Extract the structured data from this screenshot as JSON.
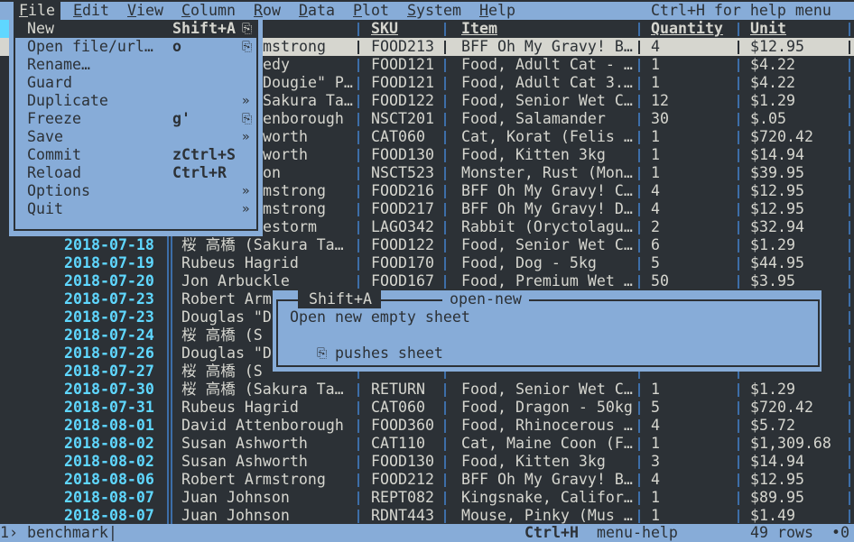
{
  "menubar": {
    "items": [
      "File",
      "Edit",
      "View",
      "Column",
      "Row",
      "Data",
      "Plot",
      "System",
      "Help"
    ],
    "hint": "Ctrl+H for help menu"
  },
  "table": {
    "headers": {
      "sku": "SKU",
      "item": "Item",
      "quantity": "Quantity",
      "unit": "Unit"
    },
    "rows": [
      {
        "date": "",
        "name": "mstrong",
        "sku": "FOOD213",
        "item": "BFF Oh My Gravy! B…",
        "qty": "4",
        "unit": "$12.95",
        "selected": true
      },
      {
        "date": "",
        "name": "edy",
        "sku": "FOOD121",
        "item": "Food, Adult Cat - …",
        "qty": "1",
        "unit": "$4.22"
      },
      {
        "date": "",
        "name": "Dougie\" P…",
        "sku": "FOOD121",
        "item": "Food, Adult Cat 3.…",
        "qty": "1",
        "unit": "$4.22"
      },
      {
        "date": "",
        "name": "Sakura Ta…",
        "sku": "FOOD122",
        "item": "Food, Senior Wet C…",
        "qty": "12",
        "unit": "$1.29"
      },
      {
        "date": "",
        "name": "enborough",
        "sku": "NSCT201",
        "item": "Food, Salamander",
        "qty": "30",
        "unit": "$.05"
      },
      {
        "date": "",
        "name": "worth",
        "sku": "CAT060",
        "item": "Cat, Korat (Felis …",
        "qty": "1",
        "unit": "$720.42"
      },
      {
        "date": "",
        "name": "worth",
        "sku": "FOOD130",
        "item": "Food, Kitten 3kg",
        "qty": "1",
        "unit": "$14.94"
      },
      {
        "date": "",
        "name": "on",
        "sku": "NSCT523",
        "item": "Monster, Rust (Mon…",
        "qty": "1",
        "unit": "$39.95"
      },
      {
        "date": "",
        "name": "mstrong",
        "sku": "FOOD216",
        "item": "BFF Oh My Gravy! C…",
        "qty": "4",
        "unit": "$12.95"
      },
      {
        "date": "",
        "name": "mstrong",
        "sku": "FOOD217",
        "item": "BFF Oh My Gravy! D…",
        "qty": "4",
        "unit": "$12.95"
      },
      {
        "date": "",
        "name": "estorm",
        "sku": "LAGO342",
        "item": "Rabbit (Oryctolagu…",
        "qty": "2",
        "unit": "$32.94"
      },
      {
        "date": "2018-07-18",
        "name": "桜 高橋 (Sakura Ta…",
        "sku": "FOOD122",
        "item": "Food, Senior Wet C…",
        "qty": "6",
        "unit": "$1.29"
      },
      {
        "date": "2018-07-19",
        "name": "Rubeus Hagrid",
        "sku": "FOOD170",
        "item": "Food, Dog - 5kg",
        "qty": "5",
        "unit": "$44.95"
      },
      {
        "date": "2018-07-20",
        "name": "Jon Arbuckle",
        "sku": "FOOD167",
        "item": "Food, Premium Wet …",
        "qty": "50",
        "unit": "$3.95"
      },
      {
        "date": "2018-07-23",
        "name": "Robert Arm",
        "sku": "",
        "item": "",
        "qty": "",
        "unit": ""
      },
      {
        "date": "2018-07-23",
        "name": "Douglas \"D",
        "sku": "",
        "item": "",
        "qty": "",
        "unit": ""
      },
      {
        "date": "2018-07-24",
        "name": "桜 高橋 (S",
        "sku": "",
        "item": "",
        "qty": "",
        "unit": ""
      },
      {
        "date": "2018-07-26",
        "name": "Douglas \"D",
        "sku": "",
        "item": "",
        "qty": "",
        "unit": ""
      },
      {
        "date": "2018-07-27",
        "name": "桜 高橋 (S",
        "sku": "",
        "item": "",
        "qty": "",
        "unit": ""
      },
      {
        "date": "2018-07-30",
        "name": "桜 高橋 (Sakura Ta…",
        "sku": "RETURN",
        "item": "Food, Senior Wet C…",
        "qty": "1",
        "unit": "$1.29"
      },
      {
        "date": "2018-07-31",
        "name": "Rubeus Hagrid",
        "sku": "CAT060",
        "item": "Food, Dragon - 50kg",
        "qty": "5",
        "unit": "$720.42"
      },
      {
        "date": "2018-08-01",
        "name": "David Attenborough",
        "sku": "FOOD360",
        "item": "Food, Rhinocerous …",
        "qty": "4",
        "unit": "$5.72"
      },
      {
        "date": "2018-08-02",
        "name": "Susan Ashworth",
        "sku": "CAT110",
        "item": "Cat, Maine Coon (F…",
        "qty": "1",
        "unit": "$1,309.68"
      },
      {
        "date": "2018-08-02",
        "name": "Susan Ashworth",
        "sku": "FOOD130",
        "item": "Food, Kitten 3kg",
        "qty": "3",
        "unit": "$14.94"
      },
      {
        "date": "2018-08-06",
        "name": "Robert Armstrong",
        "sku": "FOOD212",
        "item": "BFF Oh My Gravy! B…",
        "qty": "4",
        "unit": "$12.95"
      },
      {
        "date": "2018-08-07",
        "name": "Juan Johnson",
        "sku": "REPT082",
        "item": "Kingsnake, Califor…",
        "qty": "1",
        "unit": "$89.95"
      },
      {
        "date": "2018-08-07",
        "name": "Juan Johnson",
        "sku": "RDNT443",
        "item": "Mouse, Pinky (Mus …",
        "qty": "1",
        "unit": "$1.49"
      }
    ]
  },
  "file_menu": {
    "items": [
      {
        "label": "New",
        "key": "Shift+A",
        "icon": "⎘",
        "highlighted": true
      },
      {
        "label": "Open file/url…",
        "key": "o",
        "icon": "⎘"
      },
      {
        "label": "Rename…",
        "key": "",
        "icon": ""
      },
      {
        "label": "Guard",
        "key": "",
        "icon": ""
      },
      {
        "label": "Duplicate",
        "key": "",
        "icon": "»"
      },
      {
        "label": "Freeze",
        "key": "g'",
        "icon": "⎘"
      },
      {
        "label": "Save",
        "key": "",
        "icon": "»"
      },
      {
        "label": "Commit",
        "key": "zCtrl+S",
        "icon": ""
      },
      {
        "label": "Reload",
        "key": "Ctrl+R",
        "icon": ""
      },
      {
        "label": "Options",
        "key": "",
        "icon": "»"
      },
      {
        "label": "Quit",
        "key": "",
        "icon": "»"
      }
    ]
  },
  "popup": {
    "key": "Shift+A",
    "command": "open-new",
    "description": "Open new empty sheet",
    "icon": "⎘",
    "note": "pushes sheet"
  },
  "status": {
    "sheet": "1› benchmark|",
    "key": "Ctrl+H",
    "command": "menu-help",
    "rows": "49 rows",
    "extra": "•0"
  },
  "colors": {
    "background": "#2c3136",
    "menu": "#87acd8",
    "date": "#5fd7ff",
    "separator": "#3d6ea8",
    "selected_row": "#d6d6cf"
  }
}
